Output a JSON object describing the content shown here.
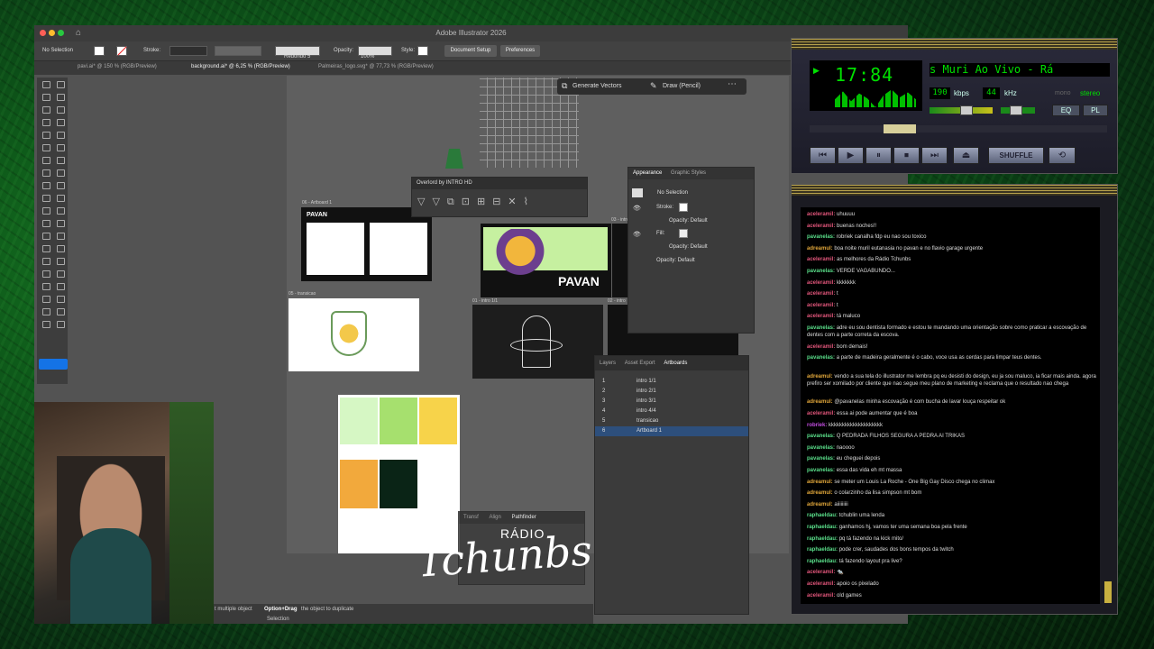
{
  "illustrator": {
    "window_title": "Adobe Illustrator 2026",
    "control_bar": {
      "selection": "No Selection",
      "stroke_label": "Stroke:",
      "brush": "Redondo 5",
      "opacity_label": "Opacity:",
      "opacity_value": "100%",
      "style_label": "Style:",
      "document_setup": "Document Setup",
      "preferences": "Preferences"
    },
    "tabs": [
      "pavi.ai* @ 150 % (RGB/Preview)",
      "background.ai* @ 6,25 % (RGB/Preview)",
      "Palmeiras_logo.svg* @ 77,73 % (RGB/Preview)"
    ],
    "context_bar": {
      "generate_vectors": "Generate Vectors",
      "draw_pencil": "Draw (Pencil)"
    },
    "overlord": {
      "title": "Overlord by INTRO HD"
    },
    "artboards_on_canvas": {
      "a06": "06 - Artboard 1",
      "a05": "05 - transicao",
      "a01": "01 - intro 1/1",
      "a03": "03 - intro",
      "a02": "02 - intro",
      "pavan_title": "PAVAN",
      "pavan_caption": "PAVAN"
    },
    "appearance": {
      "tab1": "Appearance",
      "tab2": "Graphic Styles",
      "selection": "No Selection",
      "stroke": "Stroke:",
      "opacity1": "Opacity: Default",
      "fill": "Fill:",
      "opacity2": "Opacity: Default",
      "opacity3": "Opacity: Default"
    },
    "artboards_panel": {
      "tabs": [
        "Layers",
        "Asset Export",
        "Artboards"
      ],
      "rows": [
        {
          "n": "1",
          "name": "intro 1/1"
        },
        {
          "n": "2",
          "name": "intro 2/1"
        },
        {
          "n": "3",
          "name": "intro 3/1"
        },
        {
          "n": "4",
          "name": "intro 4/4"
        },
        {
          "n": "5",
          "name": "transicao"
        },
        {
          "n": "6",
          "name": "Artboard 1"
        }
      ]
    },
    "pathfinder": {
      "tabs": [
        "Transf",
        "Align",
        "Pathfinder"
      ]
    },
    "status": {
      "hint": "t multiple object",
      "option_drag": "Option+Drag",
      "option_drag_rest": "the object to duplicate",
      "tool": "Selection"
    },
    "palette_colors": [
      "#d6f7c4",
      "#a6e06e",
      "#f7d34a",
      "#f2a93c",
      "#0a2416"
    ]
  },
  "winamp": {
    "time": "17:84",
    "track": "s    Muri Ao Vivo - Rá",
    "kbps": "190",
    "kbps_label": "kbps",
    "khz": "44",
    "khz_label": "kHz",
    "mono": "mono",
    "stereo": "stereo",
    "eq": "EQ",
    "pl": "PL",
    "shuffle": "SHUFFLE"
  },
  "chat": [
    {
      "user": "aceleramil:",
      "text": "uhuuuu",
      "color": "#e0557a"
    },
    {
      "user": "aceleramil:",
      "text": "buenas noches!!",
      "color": "#e0557a"
    },
    {
      "user": "pavanelas:",
      "text": "robriek canalha fdp eu nao sou toxico",
      "color": "#5adf8a"
    },
    {
      "user": "adreamul:",
      "text": "boa noite muril eutanasia no pavan e no flavio garage urgente",
      "color": "#e0a63a"
    },
    {
      "user": "aceleramil:",
      "text": "as melhores da Rádio Tchunbs",
      "color": "#e0557a"
    },
    {
      "user": "pavanelas:",
      "text": "VERDE VAGABUNDO...",
      "color": "#5adf8a"
    },
    {
      "user": "aceleramil:",
      "text": "kkkkkkk",
      "color": "#e0557a"
    },
    {
      "user": "aceleramil:",
      "text": "t",
      "color": "#e0557a"
    },
    {
      "user": "aceleramil:",
      "text": "t",
      "color": "#e0557a"
    },
    {
      "user": "aceleramil:",
      "text": "tá maluco",
      "color": "#e0557a"
    },
    {
      "user": "pavanelas:",
      "text": "adre eu sou dentista formado e estou te mandando uma orientação sobre como praticar a escovação de dentes com a parte correta da escova.",
      "color": "#5adf8a"
    },
    {
      "user": "aceleramil:",
      "text": "bom demais!",
      "color": "#e0557a"
    },
    {
      "user": "pavanelas:",
      "text": "a parte de madeira geralmente é o cabo, voce usa as cerdas para limpar teus dentes.",
      "color": "#5adf8a"
    },
    {
      "user": "adreamul:",
      "text": "vendo a sua tela do illustrator me lembra pq eu desisti do design, eu ja sou maluco, ia ficar mais ainda. agora prefiro ser xomilado por cliente que nao segue meu plano de marketing e reclama que o resultado nao chega",
      "color": "#e0a63a"
    },
    {
      "user": "adreamul:",
      "text": "@pavanelas minha escovação é com bucha de lavar louça respeitar ok",
      "color": "#e0a63a"
    },
    {
      "user": "aceleramil:",
      "text": "essa ai pode aumentar que é boa",
      "color": "#e0557a"
    },
    {
      "user": "robriek:",
      "text": "kkkkkkkkkkkkkkkkkkkk",
      "color": "#c24de0"
    },
    {
      "user": "pavanelas:",
      "text": "Q PEDRADA FILHOS SEGURA A PEDRA AI TRIKAS",
      "color": "#5adf8a"
    },
    {
      "user": "pavanelas:",
      "text": "naoooo",
      "color": "#5adf8a"
    },
    {
      "user": "pavanelas:",
      "text": "eu cheguei depois",
      "color": "#5adf8a"
    },
    {
      "user": "pavanelas:",
      "text": "essa das vida eh mt massa",
      "color": "#5adf8a"
    },
    {
      "user": "adreamul:",
      "text": "se meter um Louis La Roche - One Big Gay Disco chega no climax",
      "color": "#e0a63a"
    },
    {
      "user": "adreamul:",
      "text": "o colarzinho da lisa simpson mt bom",
      "color": "#e0a63a"
    },
    {
      "user": "adreamul:",
      "text": "aiiiiiiiii",
      "color": "#e0a63a"
    },
    {
      "user": "raphaeldau:",
      "text": "tchublin uma lenda",
      "color": "#5adf8a"
    },
    {
      "user": "raphaeldau:",
      "text": "ganhamos hj, vamos ter uma semana boa pela frente",
      "color": "#5adf8a"
    },
    {
      "user": "raphaeldau:",
      "text": "pq tá fazendo na kick mito/",
      "color": "#5adf8a"
    },
    {
      "user": "raphaeldau:",
      "text": "pode crer, saudades dos bons tempos da twitch",
      "color": "#5adf8a"
    },
    {
      "user": "raphaeldau:",
      "text": "tá fazendo layout pra live?",
      "color": "#5adf8a"
    },
    {
      "user": "aceleramil:",
      "text": "🐀",
      "color": "#e0557a"
    },
    {
      "user": "aceleramil:",
      "text": "apoio os pixelado",
      "color": "#e0557a"
    },
    {
      "user": "aceleramil:",
      "text": "old games",
      "color": "#e0557a"
    }
  ],
  "overlay_logo": {
    "line1": "RÁDIO",
    "line2": "Tchunbs"
  }
}
